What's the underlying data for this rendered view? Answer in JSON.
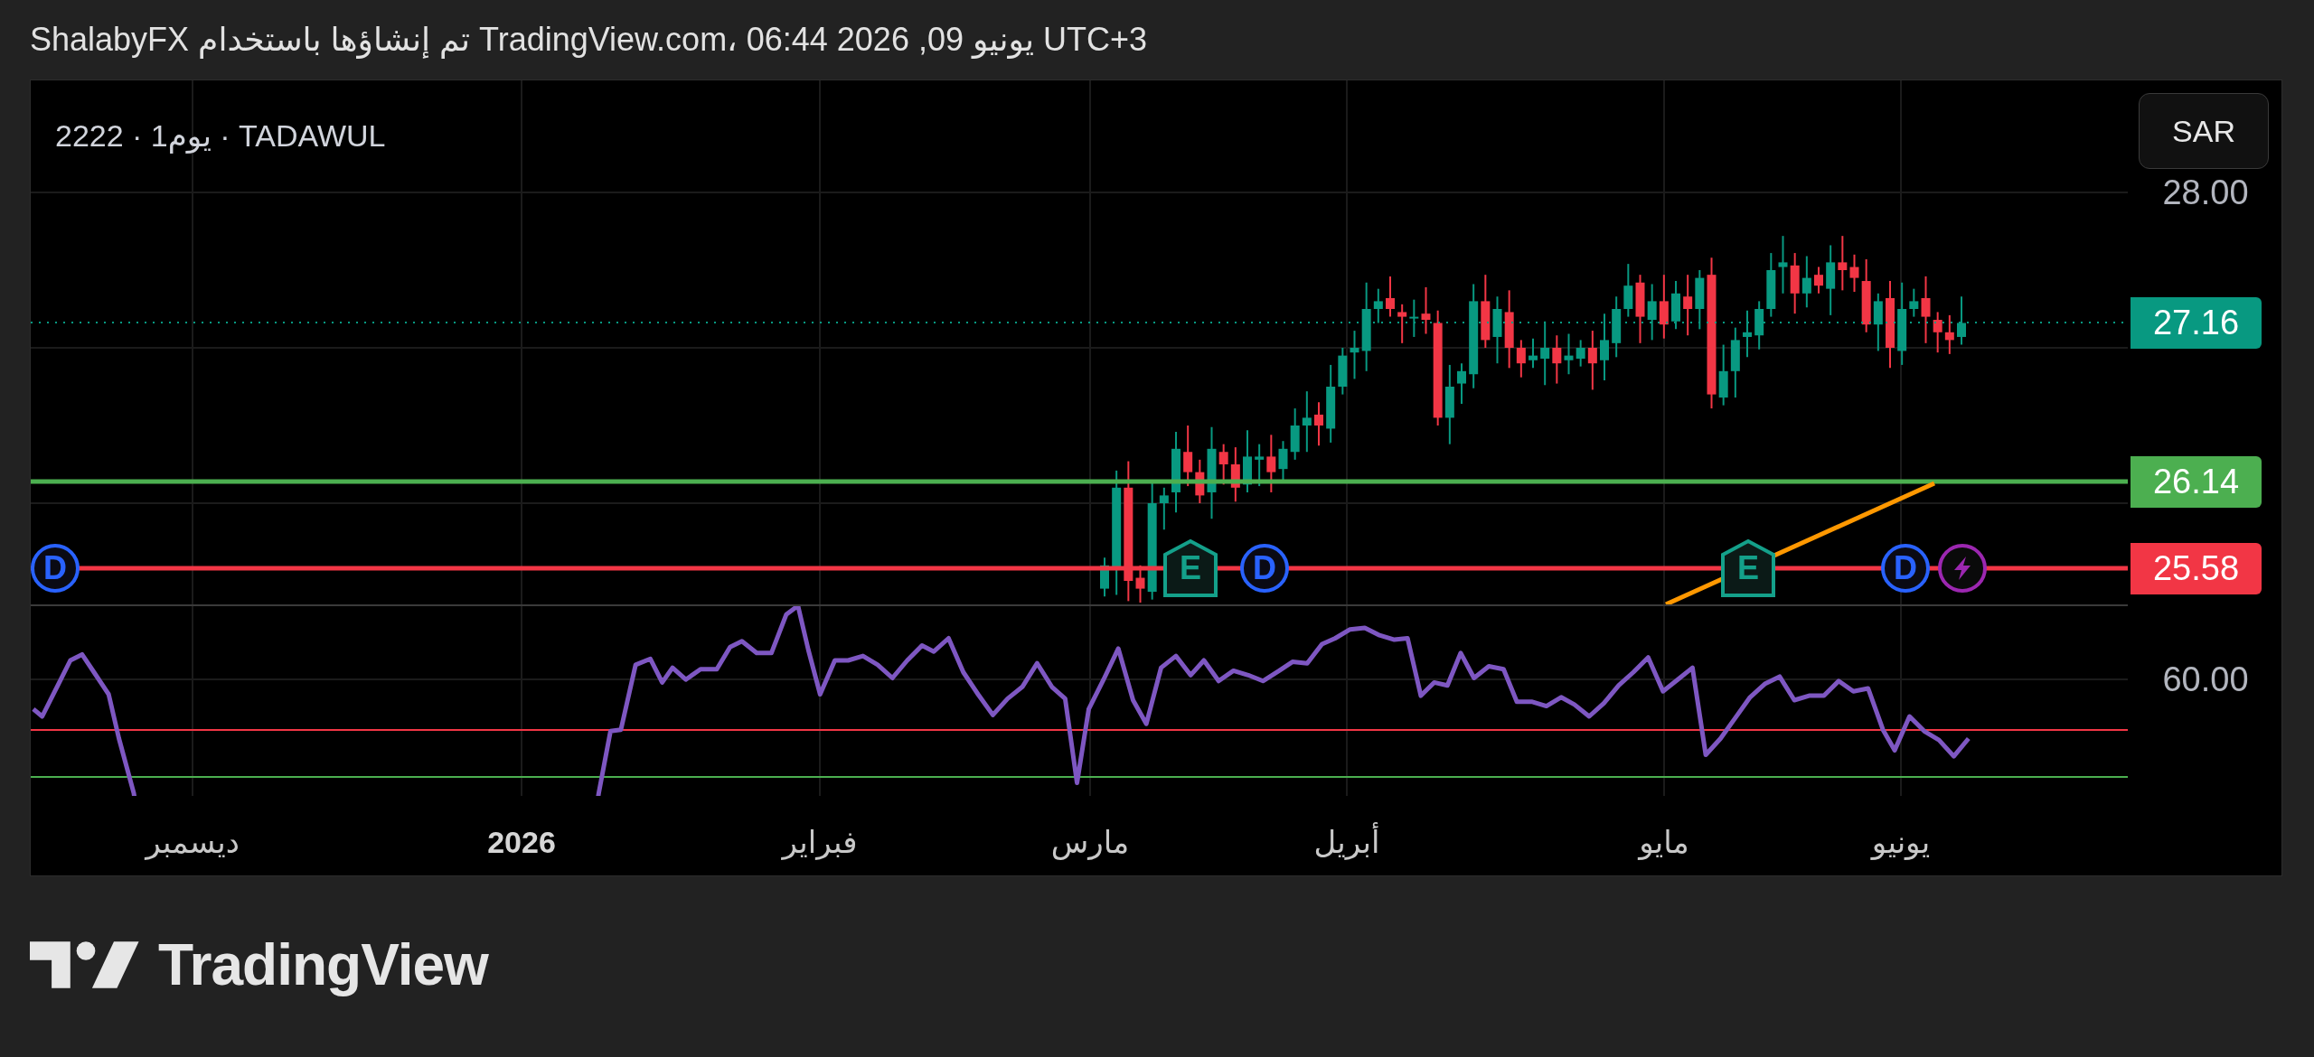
{
  "header": {
    "text": "ShalabyFX تم إنشاؤها باستخدام TradingView.com، 06:44 2026 ,09 يونيو UTC+3"
  },
  "chart": {
    "legend": "2222 · 1يوم · TADAWUL",
    "currency_button": "SAR",
    "price_axis": [
      "28.00"
    ],
    "price_tags": [
      {
        "kind": "last-price",
        "value": "27.16",
        "color": "#089981"
      },
      {
        "kind": "level",
        "value": "26.14",
        "color": "#4caf50"
      },
      {
        "kind": "level",
        "value": "25.58",
        "color": "#f23645"
      }
    ],
    "markers": [
      {
        "kind": "bolt"
      },
      {
        "kind": "circle",
        "letter": "D"
      },
      {
        "kind": "pentagon",
        "letter": "E"
      },
      {
        "kind": "circle",
        "letter": "D"
      },
      {
        "kind": "pentagon",
        "letter": "E"
      },
      {
        "kind": "circle",
        "letter": "D"
      }
    ],
    "rsi_axis": [
      "60.00"
    ],
    "time_axis": [
      {
        "kind": "month",
        "label": "يونيو"
      },
      {
        "kind": "month",
        "label": "مايو"
      },
      {
        "kind": "month",
        "label": "أبريل"
      },
      {
        "kind": "month",
        "label": "مارس"
      },
      {
        "kind": "month",
        "label": "فبراير"
      },
      {
        "kind": "year",
        "label": "2026"
      },
      {
        "kind": "month",
        "label": "ديسمبر"
      }
    ]
  },
  "logo": {
    "text": "TradingView"
  }
}
